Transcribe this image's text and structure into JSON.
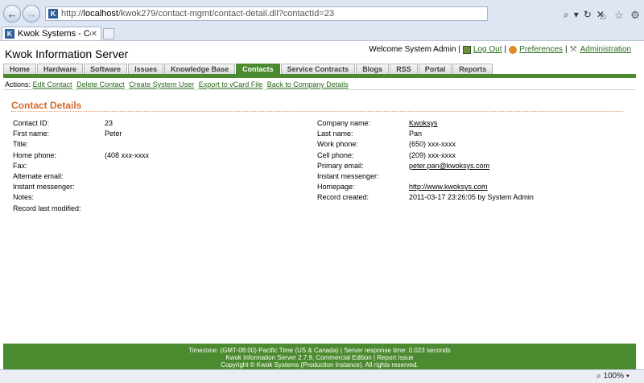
{
  "browser": {
    "url_prefix": "http://",
    "url_host": "localhost",
    "url_path": "/kwok279/contact-mgmt/contact-detail.dll?contactId=23",
    "tab_label": "Kwok Systems - Contact D...",
    "zoom": "100%"
  },
  "site": {
    "title": "Kwok Information Server",
    "welcome": "Welcome System Admin |",
    "logout": "Log Out",
    "preferences": "Preferences",
    "administration": "Administration"
  },
  "nav_tabs": [
    {
      "label": "Home"
    },
    {
      "label": "Hardware"
    },
    {
      "label": "Software"
    },
    {
      "label": "Issues"
    },
    {
      "label": "Knowledge Base"
    },
    {
      "label": "Contacts",
      "active": true
    },
    {
      "label": "Service Contracts"
    },
    {
      "label": "Blogs"
    },
    {
      "label": "RSS"
    },
    {
      "label": "Portal"
    },
    {
      "label": "Reports"
    }
  ],
  "actions": {
    "label": "Actions:",
    "items": [
      "Edit Contact",
      "Delete Contact",
      "Create System User",
      "Export to vCard File",
      "Back to Company Details"
    ]
  },
  "section_title": "Contact Details",
  "left_fields": [
    {
      "label": "Contact ID:",
      "value": "23"
    },
    {
      "label": "First name:",
      "value": "Peter"
    },
    {
      "label": "Title:",
      "value": ""
    },
    {
      "label": "Home phone:",
      "value": "(408 xxx-xxxx"
    },
    {
      "label": "Fax:",
      "value": ""
    },
    {
      "label": "Alternate email:",
      "value": ""
    },
    {
      "label": "Instant messenger:",
      "value": ""
    },
    {
      "label": "Notes:",
      "value": ""
    },
    {
      "label": "Record last modified:",
      "value": ""
    }
  ],
  "right_fields": [
    {
      "label": "Company name:",
      "value": "Kwoksys",
      "link": true
    },
    {
      "label": "Last name:",
      "value": "Pan"
    },
    {
      "label": "Work phone:",
      "value": "(650) xxx-xxxx"
    },
    {
      "label": "Cell phone:",
      "value": "(209) xxx-xxxx"
    },
    {
      "label": "Primary email:",
      "value": "peter.pan@kwoksys.com",
      "link": true
    },
    {
      "label": "Instant messenger:",
      "value": ""
    },
    {
      "label": "Homepage:",
      "value": "http://www.kwoksys.com",
      "link": true,
      "external": true
    },
    {
      "label": "Record created:",
      "value": "2011-03-17 23:26:05 by System Admin"
    }
  ],
  "footer": {
    "line1": "Timezone: (GMT-08:00) Pacific Time (US & Canada) | Server response time: 0.023 seconds",
    "line2": "Kwok Information Server 2.7.9, Commercial Edition | Report Issue",
    "line3": "Copyright © Kwok Systems (Production Instance). All rights reserved."
  }
}
